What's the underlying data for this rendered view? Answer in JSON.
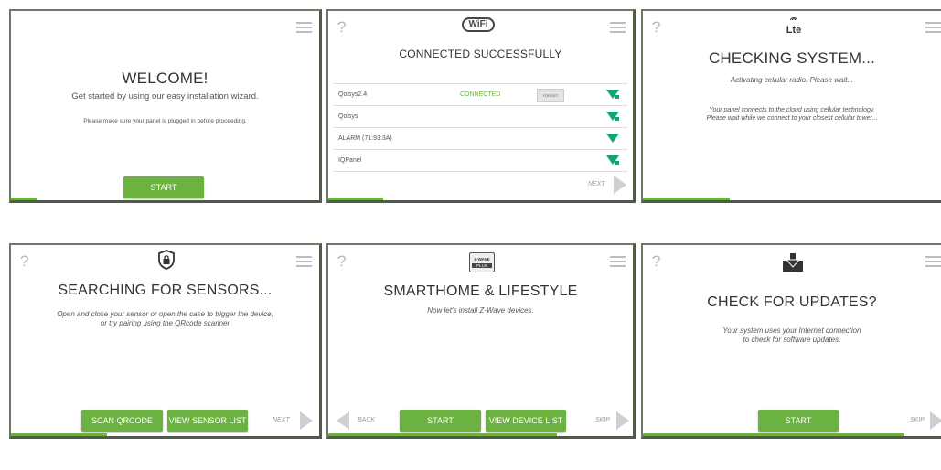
{
  "colors": {
    "accent": "#6bb240",
    "wifi": "#12a37c",
    "border": "#6e7a66"
  },
  "common": {
    "help": "?"
  },
  "panels": {
    "welcome": {
      "title": "WELCOME!",
      "subtitle": "Get started by using our easy installation wizard.",
      "note": "Please make sure your panel is plugged in before proceeding.",
      "start": "START",
      "progress": 0.08
    },
    "wifi": {
      "logo": "WiFi",
      "title": "CONNECTED SUCCESSFULLY",
      "networks": [
        {
          "name": "Qolsys2.4",
          "status": "CONNECTED",
          "action": "FORGET",
          "signal_icon": "wifi-lock-icon"
        },
        {
          "name": "Qolsys",
          "status": "",
          "action": "",
          "signal_icon": "wifi-lock-icon"
        },
        {
          "name": "ALARM (71:93:3A)",
          "status": "",
          "action": "",
          "signal_icon": "wifi-icon"
        },
        {
          "name": "IQPanel",
          "status": "",
          "action": "",
          "signal_icon": "wifi-lock-icon"
        }
      ],
      "next": "NEXT",
      "progress": 0.18
    },
    "lte": {
      "logo": "Lte",
      "title": "CHECKING SYSTEM...",
      "status": "Activating cellular radio. Please wait...",
      "info1": "Your panel connects to the cloud using cellular technology.",
      "info2": "Please wait while we connect to your closest cellular tower...",
      "progress": 0.29
    },
    "sensors": {
      "title": "SEARCHING FOR SENSORS...",
      "info1": "Open and close your sensor or open the case to trigger the device,",
      "info2": "or try pairing using the QRcode scanner",
      "scan": "SCAN QRCODE",
      "view": "VIEW SENSOR LIST",
      "next": "NEXT",
      "progress": 0.32
    },
    "smarthome": {
      "logo_top": "Z-WAVE",
      "logo_bottom": "PLUS",
      "title": "SMARTHOME & LIFESTYLE",
      "subtitle": "Now let's install Z-Wave devices.",
      "back": "BACK",
      "start": "START",
      "view": "VIEW DEVICE LIST",
      "skip": "SKIP",
      "progress": 0.75
    },
    "updates": {
      "title": "CHECK FOR UPDATES?",
      "info1": "Your system uses your Internet connection",
      "info2": "to check for software updates.",
      "start": "START",
      "skip": "SKIP",
      "progress": 0.86
    }
  }
}
